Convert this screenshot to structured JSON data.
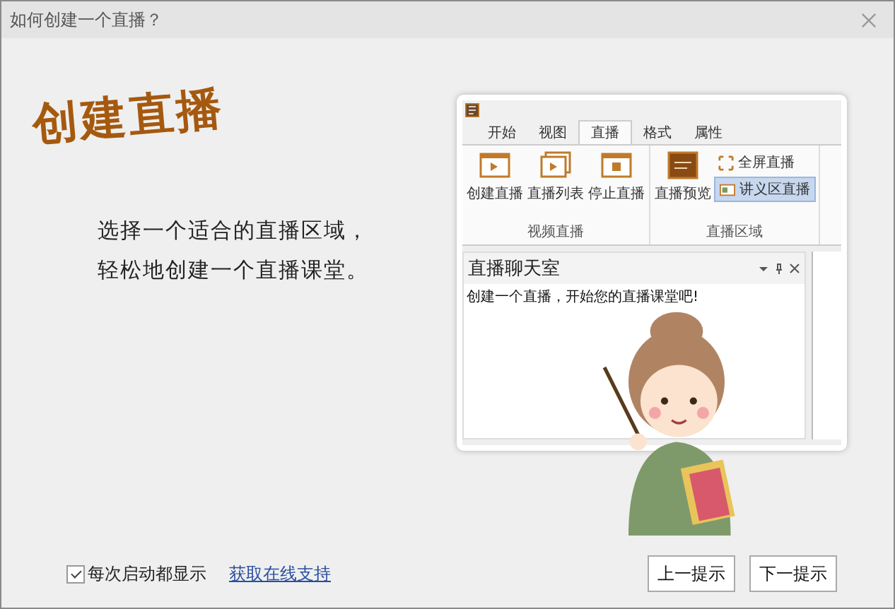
{
  "window": {
    "title": "如何创建一个直播？"
  },
  "heading": "创建直播",
  "description": [
    "选择一个适合的直播区域，",
    "轻松地创建一个直播课堂。"
  ],
  "preview": {
    "tabs": [
      {
        "label": "开始",
        "selected": false
      },
      {
        "label": "视图",
        "selected": false
      },
      {
        "label": "直播",
        "selected": true
      },
      {
        "label": "格式",
        "selected": false
      },
      {
        "label": "属性",
        "selected": false
      }
    ],
    "groups": [
      {
        "label": "视频直播",
        "items": [
          {
            "label": "创建直播",
            "kind": "large",
            "selected": false
          },
          {
            "label": "直播列表",
            "kind": "large",
            "selected": false
          },
          {
            "label": "停止直播",
            "kind": "large",
            "selected": false
          }
        ]
      },
      {
        "label": "直播区域",
        "items": [
          {
            "label": "直播预览",
            "kind": "large",
            "selected": false
          },
          {
            "label": "全屏直播",
            "kind": "small",
            "selected": false
          },
          {
            "label": "讲义区直播",
            "kind": "small",
            "selected": true
          }
        ]
      }
    ],
    "panel": {
      "title": "直播聊天室",
      "message": "创建一个直播，开始您的直播课堂吧!"
    }
  },
  "footer": {
    "show_on_startup": {
      "label": "每次启动都显示",
      "checked": true
    },
    "link": "获取在线支持",
    "buttons": [
      "上一提示",
      "下一提示"
    ]
  }
}
